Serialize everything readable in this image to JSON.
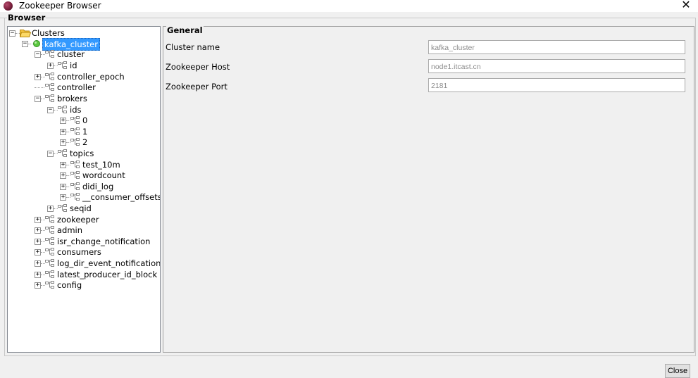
{
  "window": {
    "title": "Zookeeper Browser",
    "close_glyph": "✕"
  },
  "browser_group": {
    "label": "Browser"
  },
  "tree": {
    "root": "Clusters",
    "cluster": "kafka_cluster",
    "nodes": {
      "cluster": "cluster",
      "id": "id",
      "controller_epoch": "controller_epoch",
      "controller": "controller",
      "brokers": "brokers",
      "ids": "ids",
      "id0": "0",
      "id1": "1",
      "id2": "2",
      "topics": "topics",
      "test_10m": "test_10m",
      "wordcount": "wordcount",
      "didi_log": "didi_log",
      "consumer_offsets": "__consumer_offsets",
      "seqid": "seqid",
      "zookeeper": "zookeeper",
      "admin": "admin",
      "isr_change_notification": "isr_change_notification",
      "consumers": "consumers",
      "log_dir_event_notification": "log_dir_event_notification",
      "latest_producer_id_block": "latest_producer_id_block",
      "config": "config"
    }
  },
  "general": {
    "label": "General",
    "cluster_name_label": "Cluster name",
    "cluster_name_value": "kafka_cluster",
    "host_label": "Zookeeper Host",
    "host_value": "node1.itcast.cn",
    "port_label": "Zookeeper Port",
    "port_value": "2181"
  },
  "buttons": {
    "close": "Close"
  }
}
